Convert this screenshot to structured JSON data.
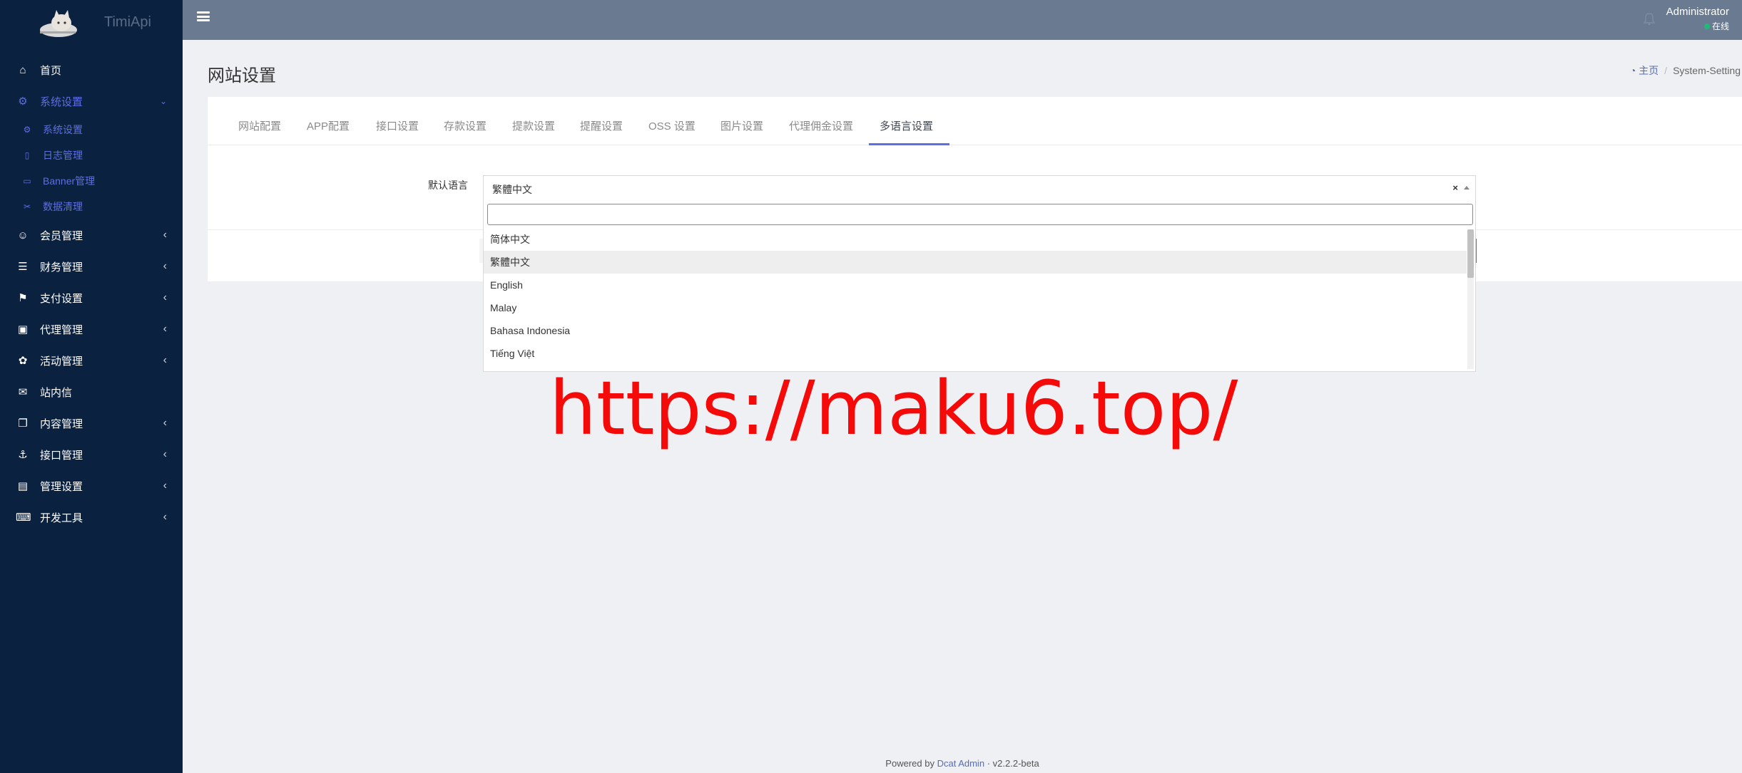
{
  "brand": {
    "name": "TimiApi",
    "logo_icon": "cat-logo"
  },
  "sidebar": {
    "items": [
      {
        "icon": "home-icon",
        "glyph": "⌂",
        "label": "首页",
        "has_arrow": false
      },
      {
        "icon": "cogs-icon",
        "glyph": "⚙",
        "label": "系统设置",
        "has_arrow": true,
        "open": true,
        "children": [
          {
            "icon": "gear-icon",
            "glyph": "⚙",
            "label": "系统设置"
          },
          {
            "icon": "file-icon",
            "glyph": "▯",
            "label": "日志管理"
          },
          {
            "icon": "image-icon",
            "glyph": "▭",
            "label": "Banner管理"
          },
          {
            "icon": "scissors-icon",
            "glyph": "✂",
            "label": "数据清理"
          }
        ]
      },
      {
        "icon": "user-icon",
        "glyph": "☺",
        "label": "会员管理",
        "has_arrow": true
      },
      {
        "icon": "database-icon",
        "glyph": "☰",
        "label": "财务管理",
        "has_arrow": true
      },
      {
        "icon": "bookmark-icon",
        "glyph": "⚑",
        "label": "支付设置",
        "has_arrow": true
      },
      {
        "icon": "id-card-icon",
        "glyph": "▣",
        "label": "代理管理",
        "has_arrow": true
      },
      {
        "icon": "activity-icon",
        "glyph": "✿",
        "label": "活动管理",
        "has_arrow": true
      },
      {
        "icon": "envelope-icon",
        "glyph": "✉",
        "label": "站内信",
        "has_arrow": false
      },
      {
        "icon": "copy-icon",
        "glyph": "❐",
        "label": "内容管理",
        "has_arrow": true
      },
      {
        "icon": "anchor-icon",
        "glyph": "⚓",
        "label": "接口管理",
        "has_arrow": true
      },
      {
        "icon": "address-card-icon",
        "glyph": "▤",
        "label": "管理设置",
        "has_arrow": true
      },
      {
        "icon": "keyboard-icon",
        "glyph": "⌨",
        "label": "开发工具",
        "has_arrow": true
      }
    ]
  },
  "topbar": {
    "user_name": "Administrator",
    "user_status": "在线"
  },
  "page": {
    "title": "网站设置",
    "breadcrumb": {
      "home": "主页",
      "current": "System-Setting"
    }
  },
  "tabs": [
    {
      "label": "网站配置",
      "active": false
    },
    {
      "label": "APP配置",
      "active": false
    },
    {
      "label": "接口设置",
      "active": false
    },
    {
      "label": "存款设置",
      "active": false
    },
    {
      "label": "提款设置",
      "active": false
    },
    {
      "label": "提醒设置",
      "active": false
    },
    {
      "label": "OSS 设置",
      "active": false
    },
    {
      "label": "图片设置",
      "active": false
    },
    {
      "label": "代理佣金设置",
      "active": false
    },
    {
      "label": "多语言设置",
      "active": true
    }
  ],
  "form": {
    "default_language_label": "默认语言",
    "selected": "繁體中文",
    "clear_glyph": "×",
    "search_value": "",
    "options": [
      "简体中文",
      "繁體中文",
      "English",
      "Malay",
      "Bahasa Indonesia",
      "Tiếng Việt"
    ],
    "highlighted_index": 1
  },
  "watermark": "https://maku6.top/",
  "footer": {
    "prefix": "Powered by",
    "link": "Dcat Admin",
    "sep": "·",
    "version": "v2.2.2-beta"
  },
  "colors": {
    "sidebar_bg": "#0b2140",
    "accent": "#5d6fe0",
    "topbar_bg": "#6a7a90",
    "watermark": "#f50a0a",
    "online": "#21b978"
  }
}
